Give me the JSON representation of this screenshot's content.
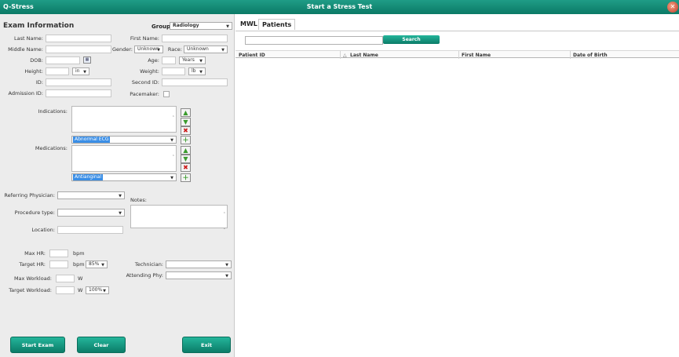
{
  "window": {
    "app_name": "Q-Stress",
    "title": "Start a Stress Test",
    "close_glyph": "✕"
  },
  "exam": {
    "title": "Exam Information",
    "group_label": "Group",
    "group_value": "Radiology",
    "last_name_label": "Last Name:",
    "first_name_label": "First Name:",
    "middle_name_label": "Middle Name:",
    "gender_label": "Gender:",
    "gender_value": "Unknown",
    "race_label": "Race:",
    "race_value": "Unknown",
    "dob_label": "DOB:",
    "age_label": "Age:",
    "age_unit": "Years",
    "height_label": "Height:",
    "height_unit": "in",
    "weight_label": "Weight:",
    "weight_unit": "lb",
    "id_label": "ID:",
    "second_id_label": "Second ID:",
    "admission_id_label": "Admission ID:",
    "pacemaker_label": "Pacemaker:",
    "indications_label": "Indications:",
    "indications_selected": "Abnormal ECG",
    "medications_label": "Medications:",
    "medications_selected": "Antianginal",
    "referring_physician_label": "Referring Physician:",
    "notes_label": "Notes:",
    "procedure_type_label": "Procedure type:",
    "location_label": "Location:",
    "max_hr_label": "Max HR:",
    "target_hr_label": "Target HR:",
    "bpm_unit": "bpm",
    "target_hr_pct": "85%",
    "technician_label": "Technician:",
    "attending_phy_label": "Attending Phy:",
    "max_workload_label": "Max Workload:",
    "target_workload_label": "Target Workload:",
    "w_unit": "W",
    "target_workload_pct": "100%"
  },
  "buttons": {
    "start_exam": "Start Exam",
    "clear": "Clear",
    "exit": "Exit"
  },
  "patients": {
    "tabs": [
      "MWL",
      "Patients"
    ],
    "active_tab": "Patients",
    "search_value": "",
    "search_button": "Search",
    "columns": [
      "Patient ID",
      "Last Name",
      "First Name",
      "Date of Birth"
    ],
    "sort_indicator": "△",
    "rows": []
  },
  "colors": {
    "accent": "#0b7c68",
    "selection": "#3a8ee6",
    "remove": "#cc1a1a",
    "add": "#3a9b2d"
  },
  "icons": [
    "calendar-icon",
    "up-arrow-icon",
    "down-arrow-icon",
    "remove-icon",
    "add-icon",
    "close-icon"
  ]
}
